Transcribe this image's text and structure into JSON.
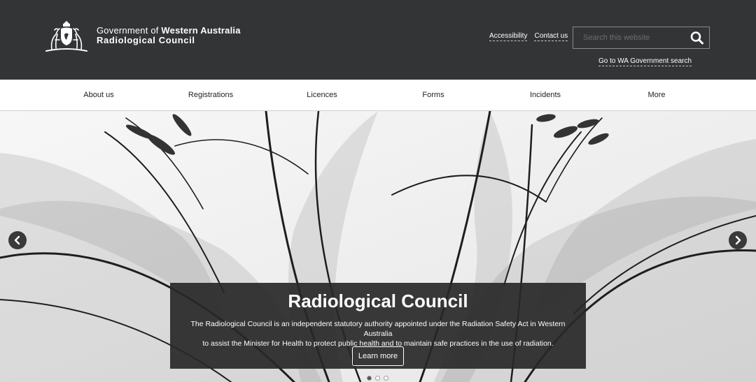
{
  "header": {
    "org_prefix": "Government of ",
    "org_state": "Western Australia",
    "org_name": "Radiological Council",
    "links": [
      "Accessibility",
      "Contact us"
    ],
    "search_placeholder": "Search this website",
    "wa_search_link": "Go to WA Government search",
    "background_color": "#333436"
  },
  "nav": {
    "items": [
      "About us",
      "Registrations",
      "Licences",
      "Forms",
      "Incidents",
      "More"
    ]
  },
  "hero": {
    "title": "Radiological Council",
    "line1": "The Radiological Council is an independent statutory authority appointed under the Radiation Safety Act in Western Australia",
    "line2": "to assist the Minister for Health to protect public health and to maintain safe practices in the use of radiation.",
    "button_label": "Learn more",
    "slides_total": 3,
    "active_slide": 1,
    "icons": {
      "prev": "chevron-left-icon",
      "next": "chevron-right-icon",
      "search": "search-icon"
    }
  }
}
